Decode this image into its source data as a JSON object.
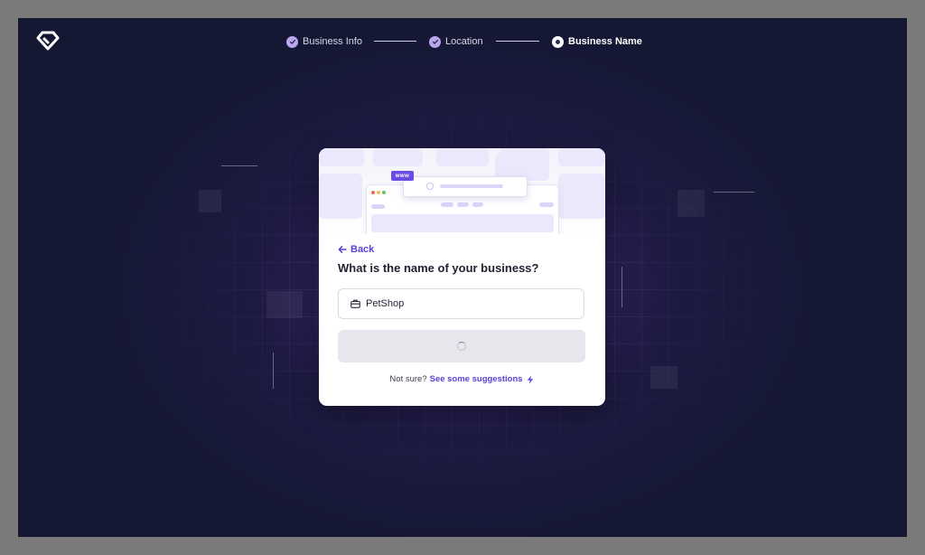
{
  "stepper": {
    "steps": [
      {
        "label": "Business Info",
        "state": "completed"
      },
      {
        "label": "Location",
        "state": "completed"
      },
      {
        "label": "Business Name",
        "state": "current"
      }
    ]
  },
  "card": {
    "illustration_badge": "www",
    "back_label": "Back",
    "question": "What is the name of your business?",
    "business_name_value": "PetShop",
    "not_sure_text": "Not sure?",
    "suggestions_link": "See some suggestions"
  },
  "colors": {
    "background": "#141833",
    "accent": "#5b3fd6",
    "step_check": "#b9a6ee",
    "button_disabled": "#e6e7ec"
  },
  "icons": {
    "logo": "diamond-logo-icon",
    "back": "arrow-left-icon",
    "input": "briefcase-icon",
    "loading": "spinner-icon",
    "suggestions": "lightning-bolt-icon",
    "completed_step": "check-circle-icon",
    "current_step": "radio-dot-icon"
  }
}
